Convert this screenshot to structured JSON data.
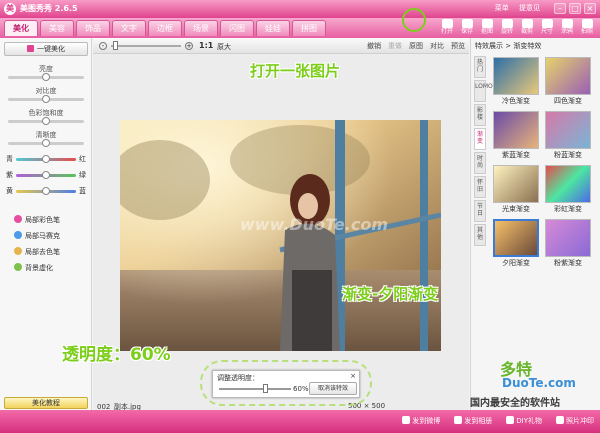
{
  "app": {
    "title": "美图秀秀 2.6.5",
    "icon": "meitu-app-icon"
  },
  "top_links": [
    "菜单",
    "提意见"
  ],
  "nav_tabs": [
    {
      "label": "美化",
      "active": true
    },
    {
      "label": "美容",
      "active": false
    },
    {
      "label": "饰品",
      "active": false
    },
    {
      "label": "文字",
      "active": false
    },
    {
      "label": "边框",
      "active": false
    },
    {
      "label": "场景",
      "active": false
    },
    {
      "label": "闪图",
      "active": false
    },
    {
      "label": "娃娃",
      "active": false
    },
    {
      "label": "拼图",
      "active": false
    }
  ],
  "toolbar": [
    "打开",
    "保存",
    "抠图",
    "旋转",
    "裁剪",
    "尺寸",
    "涂鸦",
    "拍照"
  ],
  "left_panel": {
    "one_key_label": "一键美化",
    "sliders": [
      {
        "label": "亮度",
        "value": 0.5
      },
      {
        "label": "对比度",
        "value": 0.5
      },
      {
        "label": "色彩饱和度",
        "value": 0.5
      },
      {
        "label": "清晰度",
        "value": 0.5
      }
    ],
    "color_sliders": [
      {
        "left": "青",
        "right": "红",
        "value": 0.5
      },
      {
        "left": "紫",
        "right": "绿",
        "value": 0.5
      },
      {
        "left": "黄",
        "right": "蓝",
        "value": 0.5
      }
    ],
    "tools": [
      "局部彩色笔",
      "局部马赛克",
      "局部去色笔",
      "背景虚化"
    ],
    "tutorial_label": "美化教程"
  },
  "center": {
    "one_to_one": "1:1",
    "original_size": "原大",
    "tools": [
      {
        "label": "撤销",
        "enabled": true
      },
      {
        "label": "重做",
        "enabled": false
      },
      {
        "label": "原图",
        "enabled": true
      },
      {
        "label": "对比",
        "enabled": true
      },
      {
        "label": "预览",
        "enabled": true
      }
    ],
    "watermark": "www.DuoTe.com",
    "filename": "002_副本.jpg",
    "ratio": "500 × 500"
  },
  "opacity_dialog": {
    "title": "调整透明度：",
    "close": "×",
    "value": "60%",
    "button": "取消该特效"
  },
  "right_panel": {
    "breadcrumb": "特效展示 > 渐变特效",
    "vertical_tabs": [
      "热门",
      "LOMO",
      "影楼",
      "渐变",
      "时尚",
      "怀旧",
      "节日",
      "其他"
    ],
    "active_tab": "渐变",
    "thumbs": [
      "冷色渐变",
      "四色渐变",
      "紫蓝渐变",
      "粉蓝渐变",
      "光束渐变",
      "彩虹渐变",
      "夕阳渐变",
      "粉紫渐变"
    ],
    "selected": "夕阳渐变"
  },
  "annotations": {
    "open": "打开一张图片",
    "effect": "渐变-夕阳渐变",
    "opacity": "透明度：60%"
  },
  "status_bar": [
    "发到微博",
    "发到相册",
    "DIY礼物",
    "照片冲印"
  ],
  "logo": {
    "big": "多特",
    "small": "软件站",
    "domain": "DuoTe.com",
    "slogan": "国内最安全的软件站"
  }
}
